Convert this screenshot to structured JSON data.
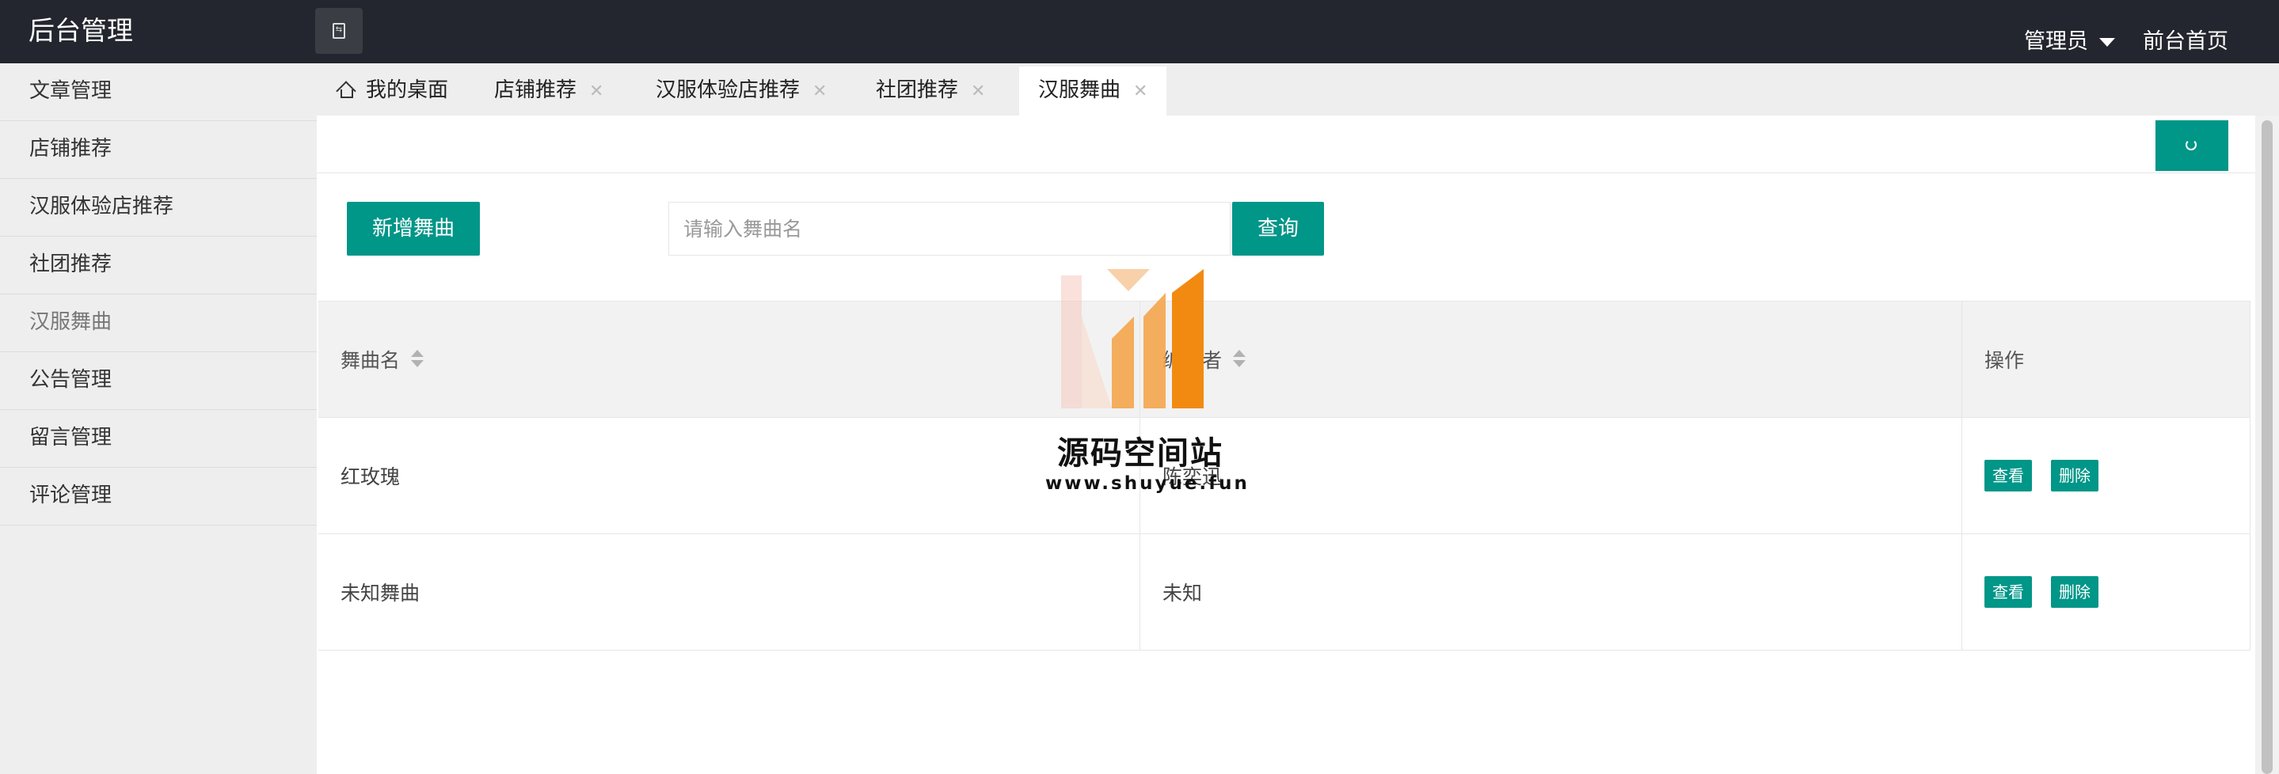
{
  "header": {
    "app_title": "后台管理",
    "user_menu": "管理员",
    "home_link": "前台首页"
  },
  "sidebar": {
    "items": [
      {
        "label": "文章管理"
      },
      {
        "label": "店铺推荐"
      },
      {
        "label": "汉服体验店推荐"
      },
      {
        "label": "社团推荐"
      },
      {
        "label": "汉服舞曲",
        "active": true
      },
      {
        "label": "公告管理"
      },
      {
        "label": "留言管理"
      },
      {
        "label": "评论管理"
      }
    ]
  },
  "tabs": [
    {
      "label": "我的桌面",
      "icon": "home-icon"
    },
    {
      "label": "店铺推荐",
      "closable": true
    },
    {
      "label": "汉服体验店推荐",
      "closable": true
    },
    {
      "label": "社团推荐",
      "closable": true
    },
    {
      "label": "汉服舞曲",
      "closable": true,
      "active": true
    }
  ],
  "tab_close_glyph": "✕",
  "toolbar": {
    "add_label": "新增舞曲",
    "search_placeholder": "请输入舞曲名",
    "search_value": "",
    "search_label": "查询"
  },
  "table": {
    "columns": [
      "舞曲名",
      "编舞者",
      "操作"
    ],
    "rows": [
      {
        "name": "红玫瑰",
        "author": "陈奕迅"
      },
      {
        "name": "未知舞曲",
        "author": "未知"
      }
    ],
    "view_label": "查看",
    "delete_label": "删除"
  },
  "watermark": {
    "title": "源码空间站",
    "url": "www.shuyue.fun"
  },
  "colors": {
    "header_bg": "#23262e",
    "accent": "#009688",
    "sidebar_bg": "#eeeeee"
  }
}
